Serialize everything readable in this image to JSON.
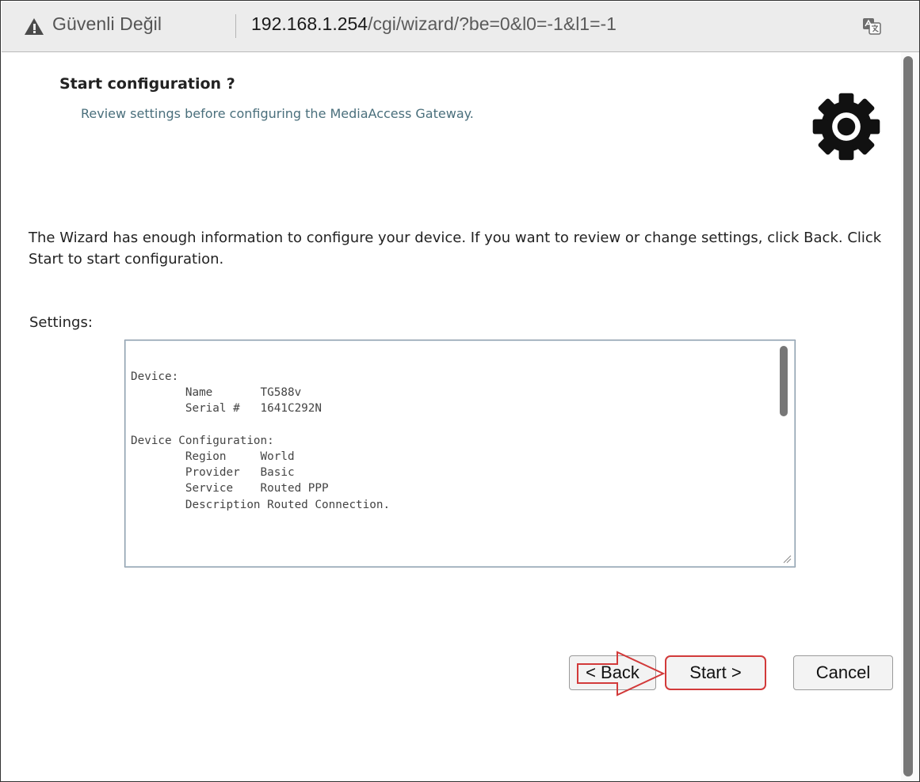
{
  "browser": {
    "security_label": "Güvenli Değil",
    "url_host": "192.168.1.254",
    "url_path": "/cgi/wizard/?be=0&l0=-1&l1=-1",
    "icons": [
      "warning-icon",
      "translate-icon"
    ]
  },
  "wizard": {
    "title": "Start configuration ?",
    "subtitle": "Review settings before configuring the MediaAccess Gateway.",
    "icon": "gear-icon",
    "intro": "The Wizard has enough information to configure your device. If you want to review or change settings, click Back. Click Start to start configuration.",
    "settings_label": "Settings:",
    "settings_text": "Device:\n        Name       TG588v\n        Serial #   1641C292N\n\nDevice Configuration:\n        Region     World\n        Provider   Basic\n        Service    Routed PPP\n        Description Routed Connection."
  },
  "buttons": {
    "back": "< Back",
    "start": "Start >",
    "cancel": "Cancel"
  },
  "colors": {
    "subtitle": "#4a6f7c",
    "annotation_red": "#d23a3a",
    "gear": "#111111"
  }
}
